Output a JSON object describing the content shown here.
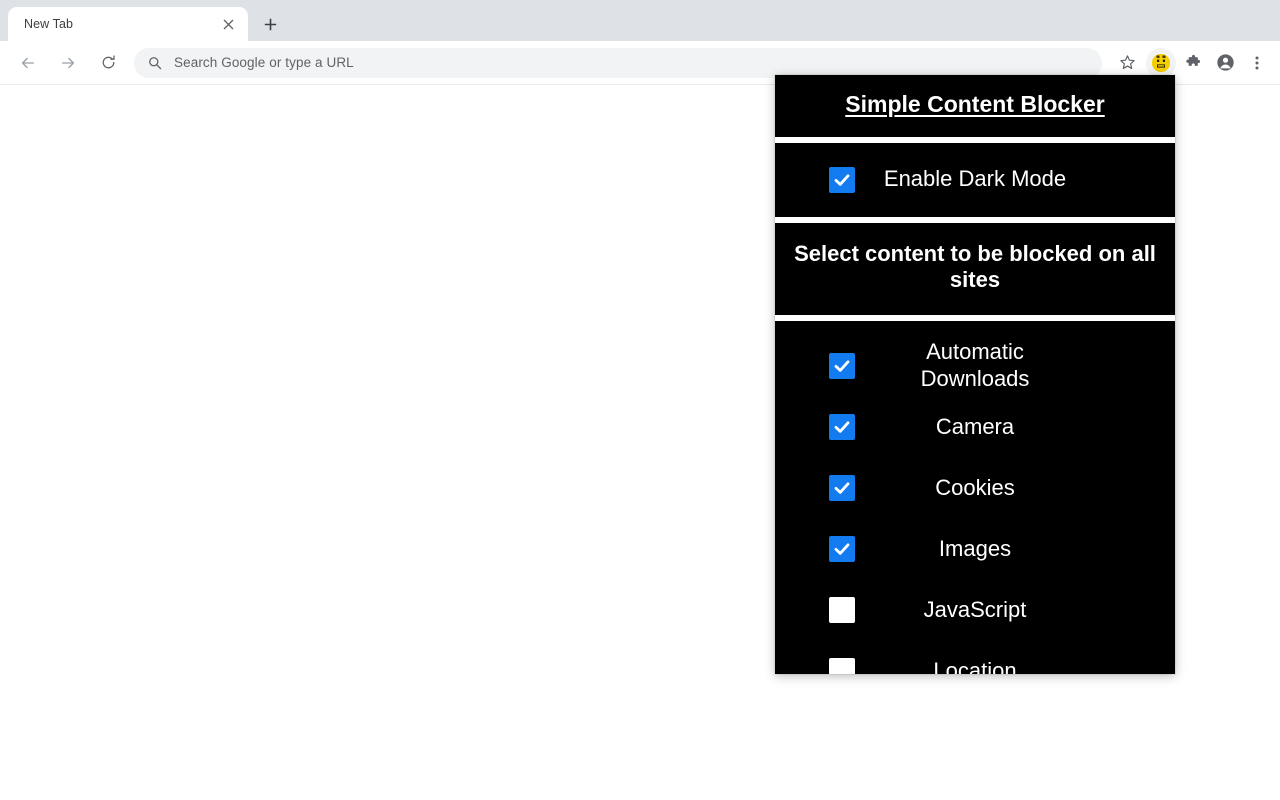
{
  "browser": {
    "tab": {
      "title": "New Tab",
      "close_icon": "close-icon"
    },
    "new_tab_button_icon": "plus-icon",
    "nav": {
      "back_icon": "arrow-back-icon",
      "forward_icon": "arrow-forward-icon",
      "reload_icon": "reload-icon"
    },
    "omnibox": {
      "value": "",
      "placeholder": "Search Google or type a URL",
      "search_icon": "search-icon"
    },
    "toolbar_icons": {
      "bookmark": "star-icon",
      "active_extension": "content-blocker-extension-icon",
      "extensions": "puzzle-piece-icon",
      "profile": "profile-avatar-icon",
      "menu": "three-dot-menu-icon"
    }
  },
  "popup": {
    "title": "Simple Content Blocker",
    "dark_mode": {
      "label": "Enable Dark Mode",
      "checked": true
    },
    "section_heading": "Select content to be blocked on all sites",
    "items": [
      {
        "label": "Automatic Downloads",
        "checked": true
      },
      {
        "label": "Camera",
        "checked": true
      },
      {
        "label": "Cookies",
        "checked": true
      },
      {
        "label": "Images",
        "checked": true
      },
      {
        "label": "JavaScript",
        "checked": false
      },
      {
        "label": "Location",
        "checked": false
      }
    ],
    "colors": {
      "background": "#000000",
      "text": "#ffffff",
      "checkbox_checked": "#127bf0",
      "checkbox_unchecked": "#ffffff"
    }
  }
}
